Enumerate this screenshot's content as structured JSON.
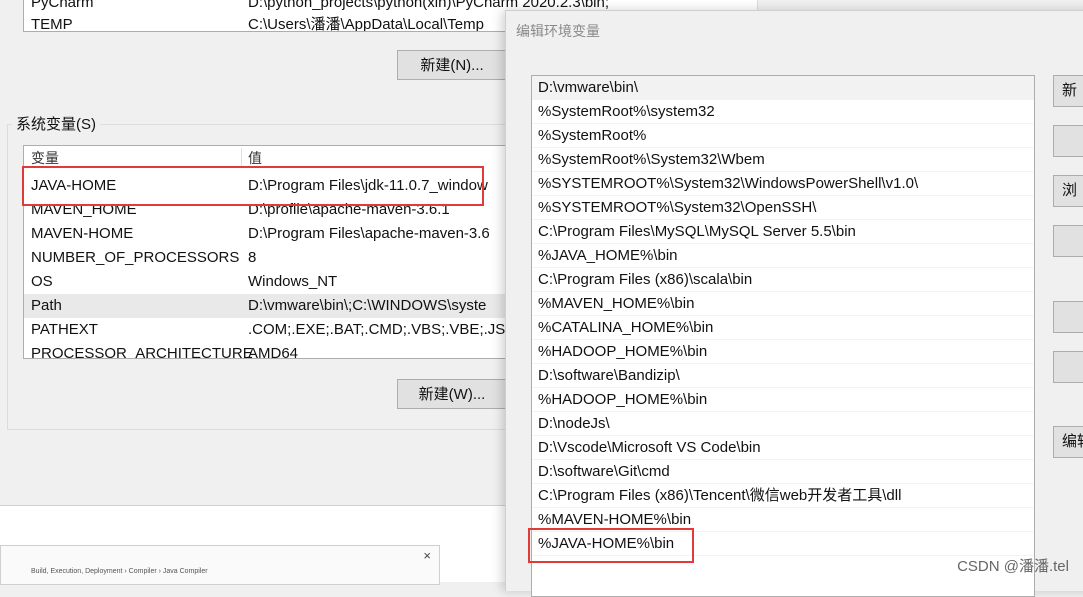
{
  "user_vars": {
    "rows": [
      {
        "name": "PyCharm",
        "value": "D:\\python_projects\\python(xin)\\PyCharm 2020.2.3\\bin;"
      },
      {
        "name": "TEMP",
        "value": "C:\\Users\\潘潘\\AppData\\Local\\Temp"
      }
    ],
    "new_button": "新建(N)..."
  },
  "system_vars": {
    "group_label": "系统变量(S)",
    "col_name": "变量",
    "col_value": "值",
    "rows": [
      {
        "name": "JAVA-HOME",
        "value": "D:\\Program Files\\jdk-11.0.7_window"
      },
      {
        "name": "MAVEN_HOME",
        "value": "D:\\profile\\apache-maven-3.6.1"
      },
      {
        "name": "MAVEN-HOME",
        "value": "D:\\Program Files\\apache-maven-3.6"
      },
      {
        "name": "NUMBER_OF_PROCESSORS",
        "value": "8"
      },
      {
        "name": "OS",
        "value": "Windows_NT"
      },
      {
        "name": "Path",
        "value": "D:\\vmware\\bin\\;C:\\WINDOWS\\syste"
      },
      {
        "name": "PATHEXT",
        "value": ".COM;.EXE;.BAT;.CMD;.VBS;.VBE;.JS;."
      },
      {
        "name": "PROCESSOR_ARCHITECTURE",
        "value": "AMD64"
      }
    ],
    "new_button": "新建(W)..."
  },
  "edit_dialog": {
    "title": "编辑环境变量",
    "paths": [
      "D:\\vmware\\bin\\",
      "%SystemRoot%\\system32",
      "%SystemRoot%",
      "%SystemRoot%\\System32\\Wbem",
      "%SYSTEMROOT%\\System32\\WindowsPowerShell\\v1.0\\",
      "%SYSTEMROOT%\\System32\\OpenSSH\\",
      "C:\\Program Files\\MySQL\\MySQL Server 5.5\\bin",
      "%JAVA_HOME%\\bin",
      "C:\\Program Files (x86)\\scala\\bin",
      "%MAVEN_HOME%\\bin",
      "%CATALINA_HOME%\\bin",
      "%HADOOP_HOME%\\bin",
      "D:\\software\\Bandizip\\",
      "%HADOOP_HOME%\\bin",
      "D:\\nodeJs\\",
      "D:\\Vscode\\Microsoft VS Code\\bin",
      "D:\\software\\Git\\cmd",
      "C:\\Program Files (x86)\\Tencent\\微信web开发者工具\\dll",
      "%MAVEN-HOME%\\bin",
      "%JAVA-HOME%\\bin"
    ],
    "side_buttons": [
      "新",
      "",
      "浏",
      "",
      "",
      "",
      "编辑"
    ]
  },
  "mini_window": {
    "close": "×",
    "text": "Build, Execution, Deployment  ›  Compiler  ›  Java Compiler"
  },
  "watermark": "CSDN @潘潘.tel",
  "colors": {
    "highlight_border": "#e03a3a"
  }
}
